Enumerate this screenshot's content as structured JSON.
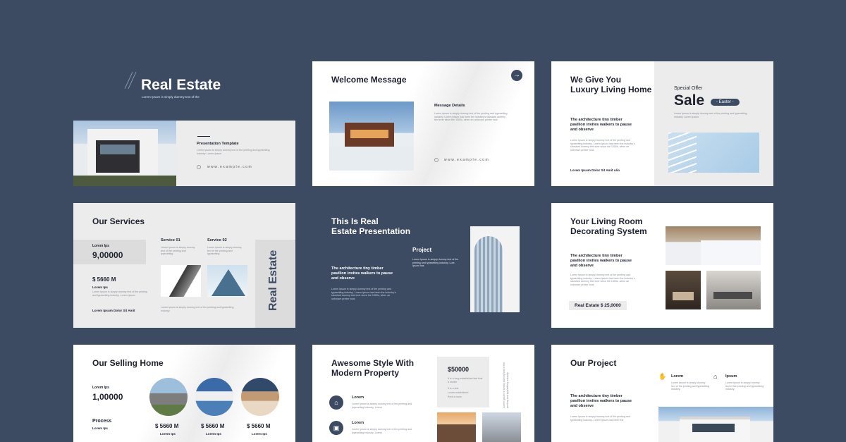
{
  "slide1": {
    "title": "Real Estate",
    "tagline": "Lorem Ipsum is simply dummy text of the",
    "subtitle": "Presentation Template",
    "desc": "Lorem Ipsum is simply dummy text of the printing and typesetting industry. Lorem Ipsum",
    "website": "www.example.com"
  },
  "slide2": {
    "title": "Welcome Message",
    "subtitle": "Message Details",
    "desc": "Lorem Ipsum is simply dummy text of the printing and typesetting industry. Lorem Ipsum has been the industry's standard dummy text ever since the 1500s, when an unknown printer took",
    "website": "www.example.com",
    "arrow": "→"
  },
  "slide3": {
    "title_line1": "We Give You",
    "title_line2": "Luxury Living Home",
    "sub": "The architecture tiny timber pavilion invites walkers to pause and observe",
    "desc": "Lorem Ipsum is simply dummy text of the printing and typesetting industry. Lorem Ipsum has been the industry's standard dummy text ever since the 1500s, when an unknown printer took",
    "footer": "Lorem Ipsum Dolor Sit Amit ulio",
    "offer": "Special Offer",
    "sale": "Sale",
    "badge": "- Easter -",
    "offer_desc": "Lorem Ipsum is simply dummy text of the printing and typesetting industry. Lorem Ipsum"
  },
  "slide4": {
    "title": "Our Services",
    "label": "Lorem Ips",
    "number": "9,00000",
    "price": "$ 5660 M",
    "price_label": "Lorem Ips",
    "desc": "Lorem Ipsum is simply dummy text of the printing and typesetting industry. Lorem Ipsum",
    "footer": "Lorem Ipsum Dolor Sit Amit",
    "service1": "Service 01",
    "service2": "Service 02",
    "service_desc": "Lorem Ipsum is simply dummy text of the printing and typesetting",
    "bottom_desc": "Lorem Ipsum is simply dummy text of the printing and typesetting industry.",
    "vertical": "Real Estate"
  },
  "slide5": {
    "title_line1": "This Is Real",
    "title_line2": "Estate Presentation",
    "sub": "The architecture tiny timber pavilion invites walkers to pause and observe",
    "desc": "Lorem Ipsum is simply dummy text of the printing and typesetting industry. Lorem Ipsum has been the industry's standard dummy text ever since the 1500s, when an unknown printer took",
    "project": "Project",
    "project_desc": "Lorem Ipsum is simply dummy text of the printing and typesetting industry. Lore, Ipsum has"
  },
  "slide6": {
    "title_line1": "Your Living Room",
    "title_line2": "Decorating System",
    "sub": "The architecture tiny timber pavilion invites walkers to pause and observe",
    "desc": "Lorem Ipsum is simply dummy text of the printing and typesetting industry. Lorem Ipsum has been the industry's standard dummy text ever since the 1500s, when an unknown printer took",
    "price_tag": "Real Estate $ 25,0000"
  },
  "slide7": {
    "title": "Our Selling Home",
    "label": "Lorem Ips",
    "number": "1,00000",
    "process": "Process",
    "process_label": "Lorem Ips",
    "prices": [
      "$ 5660 M",
      "$ 5660 M",
      "$ 5660 M"
    ],
    "price_labels": [
      "Lorem Ips",
      "Lorem Ips",
      "Lorem Ips"
    ]
  },
  "slide8": {
    "title_line1": "Awesome Style With",
    "title_line2": "Modern Property",
    "item1": "Lorem",
    "item2": "Lorem",
    "item_desc": "Lorem Ipsum is simply dummy text of the printing and typesetting industry. Lorem",
    "price": "$50000",
    "price_desc": "It is a long established fact that a reader",
    "bullets": [
      "It is a text",
      "Lorem established",
      "Rent a room"
    ],
    "vertical_desc": "Lorem Ipsum is simply dummy text of the printing and typesetting industry."
  },
  "slide9": {
    "title": "Our Project",
    "sub": "The architecture tiny timber pavilion invites walkers to pause and observe",
    "desc": "Lorem Ipsum is simply dummy text of the printing and typesetting industry. Lorem Ipsum has been the",
    "item1": "Lorem",
    "item2": "Ipsum",
    "item_desc": "Lorem Ipsum is simply dummy text of the printing and typesetting industry."
  }
}
